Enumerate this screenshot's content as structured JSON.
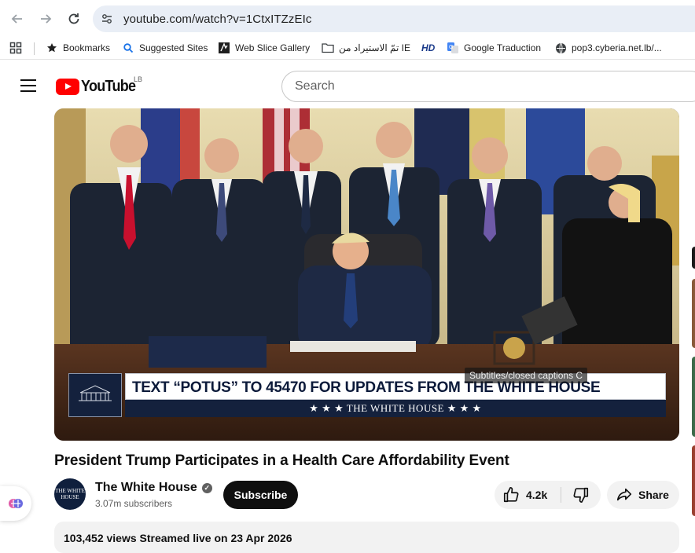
{
  "browser": {
    "url": "youtube.com/watch?v=1CtxITZzEIc",
    "bookmarks": [
      {
        "label": "Bookmarks",
        "icon": "star-icon"
      },
      {
        "label": "Suggested Sites",
        "icon": "search-icon"
      },
      {
        "label": "Web Slice Gallery",
        "icon": "web-slice-icon"
      },
      {
        "label": "تمّ الاستيراد من IE",
        "icon": "folder-icon"
      },
      {
        "label": "HD",
        "icon": "hd-icon"
      },
      {
        "label": "Google Traduction",
        "icon": "translate-icon"
      },
      {
        "label": "pop3.cyberia.net.lb/...",
        "icon": "globe-icon"
      }
    ]
  },
  "youtube": {
    "logo_text": "YouTube",
    "region": "LB",
    "search_placeholder": "Search"
  },
  "video": {
    "banner_text": "TEXT “POTUS” TO 45470 FOR UPDATES FROM THE WHITE HOUSE",
    "banner_sub": "★ ★ ★   THE WHITE HOUSE   ★ ★ ★",
    "captions_tooltip": "Subtitles/closed captions  C",
    "title": "President Trump Participates in a Health Care Affordability Event"
  },
  "channel": {
    "name": "The White House",
    "subscribers": "3.07m subscribers",
    "avatar_text": "THE WHITE HOUSE",
    "subscribe_label": "Subscribe"
  },
  "actions": {
    "likes": "4.2k",
    "share_label": "Share"
  },
  "description": {
    "summary": "103,452 views  Streamed live on 23 Apr 2026"
  },
  "colors": {
    "youtube_red": "#ff0000",
    "omnibox_bg": "#e9eef6",
    "chip_bg": "#f2f2f2",
    "subscribe_bg": "#0f0f0f"
  }
}
